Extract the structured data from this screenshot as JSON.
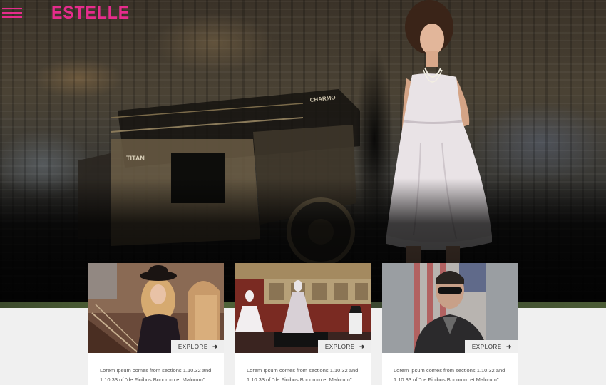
{
  "header": {
    "brand": "ESTELLE",
    "menu_icon": "hamburger-icon"
  },
  "hero": {
    "truck_labels": [
      "TITAN",
      "CHARMO"
    ]
  },
  "cards": [
    {
      "button_label": "EXPLORE",
      "button_icon": "arrow-right-icon",
      "description": "Lorem Ipsum comes from sections 1.10.32 and 1.10.33 of \"de Finibus Bonorum et Malorum\""
    },
    {
      "button_label": "EXPLORE",
      "button_icon": "arrow-right-icon",
      "description": "Lorem Ipsum comes from sections 1.10.32 and 1.10.33 of \"de Finibus Bonorum et Malorum\""
    },
    {
      "button_label": "EXPLORE",
      "button_icon": "arrow-right-icon",
      "description": "Lorem Ipsum comes from sections 1.10.32 and 1.10.33 of \"de Finibus Bonorum et Malorum\""
    }
  ],
  "colors": {
    "accent": "#e62c8c",
    "page_bg": "#f0f0f0",
    "card_bg": "#ffffff"
  }
}
